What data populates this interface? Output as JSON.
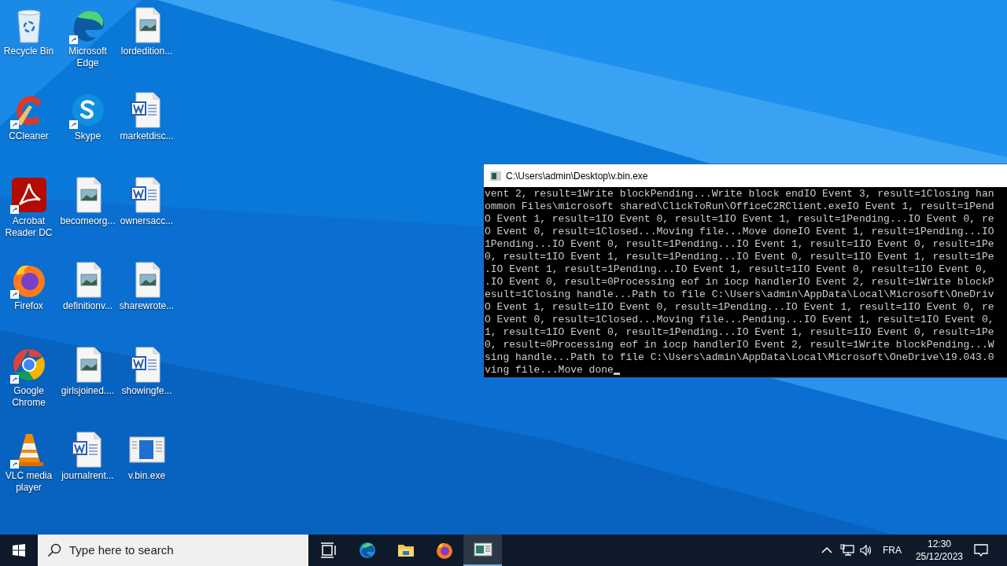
{
  "desktop_icons": [
    {
      "label": "Recycle Bin",
      "kind": "recycle",
      "shortcut": false
    },
    {
      "label": "Microsoft Edge",
      "kind": "edge",
      "shortcut": true
    },
    {
      "label": "lordedition...",
      "kind": "image-file",
      "shortcut": false
    },
    {
      "label": "CCleaner",
      "kind": "ccleaner",
      "shortcut": true
    },
    {
      "label": "Skype",
      "kind": "skype",
      "shortcut": true
    },
    {
      "label": "marketdisc...",
      "kind": "word-doc",
      "shortcut": false
    },
    {
      "label": "Acrobat Reader DC",
      "kind": "acrobat",
      "shortcut": true
    },
    {
      "label": "becomeorg...",
      "kind": "image-file",
      "shortcut": false
    },
    {
      "label": "ownersacc...",
      "kind": "word-doc",
      "shortcut": false
    },
    {
      "label": "Firefox",
      "kind": "firefox",
      "shortcut": true
    },
    {
      "label": "definitionv...",
      "kind": "image-file",
      "shortcut": false
    },
    {
      "label": "sharewrote...",
      "kind": "image-file",
      "shortcut": false
    },
    {
      "label": "Google Chrome",
      "kind": "chrome",
      "shortcut": true
    },
    {
      "label": "girlsjoined....",
      "kind": "image-file",
      "shortcut": false
    },
    {
      "label": "showingfe...",
      "kind": "word-doc",
      "shortcut": false
    },
    {
      "label": "VLC media player",
      "kind": "vlc",
      "shortcut": true
    },
    {
      "label": "journalrent...",
      "kind": "word-doc",
      "shortcut": false
    },
    {
      "label": "v.bin.exe",
      "kind": "exe",
      "shortcut": false
    }
  ],
  "console": {
    "title": "C:\\Users\\admin\\Desktop\\v.bin.exe",
    "cursor": true,
    "lines": [
      "vent 2, result=1Write blockPending...Write block endIO Event 3, result=1Closing han",
      "ommon Files\\microsoft shared\\ClickToRun\\OfficeC2RClient.exeIO Event 1, result=1Pend",
      "O Event 1, result=1IO Event 0, result=1IO Event 1, result=1Pending...IO Event 0, re",
      "O Event 0, result=1Closed...Moving file...Move doneIO Event 1, result=1Pending...IO",
      "1Pending...IO Event 0, result=1Pending...IO Event 1, result=1IO Event 0, result=1Pe",
      "0, result=1IO Event 1, result=1Pending...IO Event 0, result=1IO Event 1, result=1Pe",
      ".IO Event 1, result=1Pending...IO Event 1, result=1IO Event 0, result=1IO Event 0,",
      ".IO Event 0, result=0Processing eof in iocp handlerIO Event 2, result=1Write blockP",
      "esult=1Closing handle...Path to file C:\\Users\\admin\\AppData\\Local\\Microsoft\\OneDriv",
      "O Event 1, result=1IO Event 0, result=1Pending...IO Event 1, result=1IO Event 0, re",
      "O Event 0, result=1Closed...Moving file...Pending...IO Event 1, result=1IO Event 0,",
      "1, result=1IO Event 0, result=1Pending...IO Event 1, result=1IO Event 0, result=1Pe",
      "0, result=0Processing eof in iocp handlerIO Event 2, result=1Write blockPending...W",
      "sing handle...Path to file C:\\Users\\admin\\AppData\\Local\\Microsoft\\OneDrive\\19.043.0",
      "ving file...Move done"
    ]
  },
  "taskbar": {
    "search": {
      "placeholder": "Type here to search"
    },
    "apps": [
      {
        "kind": "task-view",
        "selected": false
      },
      {
        "kind": "edge",
        "selected": false
      },
      {
        "kind": "explorer",
        "selected": false
      },
      {
        "kind": "firefox",
        "selected": false
      },
      {
        "kind": "console",
        "selected": true
      }
    ],
    "language": "FRA",
    "time": "12:30",
    "date": "25/12/2023"
  }
}
